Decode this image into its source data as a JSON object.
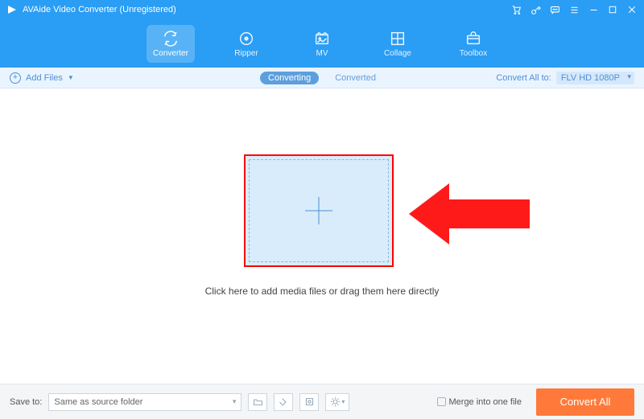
{
  "window": {
    "title": "AVAide Video Converter (Unregistered)"
  },
  "modes": [
    {
      "id": "converter",
      "label": "Converter"
    },
    {
      "id": "ripper",
      "label": "Ripper"
    },
    {
      "id": "mv",
      "label": "MV"
    },
    {
      "id": "collage",
      "label": "Collage"
    },
    {
      "id": "toolbox",
      "label": "Toolbox"
    }
  ],
  "toolbar": {
    "add_files_label": "Add Files",
    "tabs": {
      "converting": "Converting",
      "converted": "Converted"
    },
    "convert_all_label": "Convert All to:",
    "convert_all_value": "FLV HD 1080P"
  },
  "workspace": {
    "hint": "Click here to add media files or drag them here directly"
  },
  "footer": {
    "save_label": "Save to:",
    "save_value": "Same as source folder",
    "merge_label": "Merge into one file",
    "convert_button": "Convert All"
  },
  "annotation": {
    "arrow_color": "#ff1a1a"
  }
}
